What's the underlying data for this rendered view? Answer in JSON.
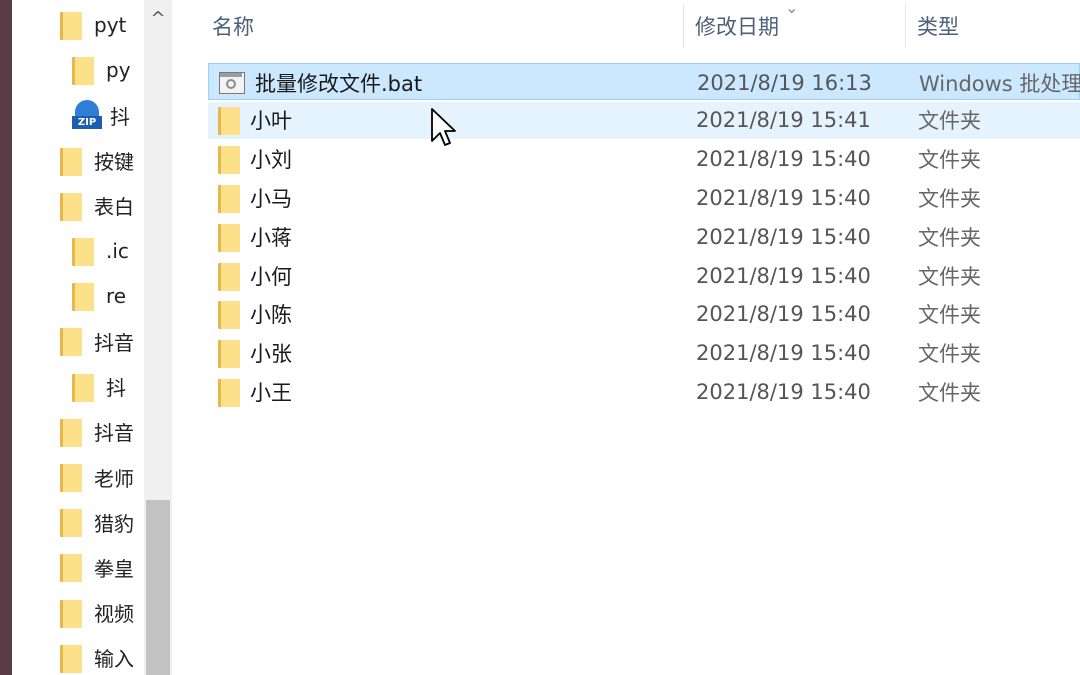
{
  "nav": {
    "items": [
      {
        "label": "pyt",
        "indent": 0,
        "icon": "folder-icon"
      },
      {
        "label": "py",
        "indent": 1,
        "icon": "folder-icon"
      },
      {
        "label": "抖",
        "indent": 1,
        "icon": "zip-icon"
      },
      {
        "label": "按键",
        "indent": 0,
        "icon": "folder-icon"
      },
      {
        "label": "表白",
        "indent": 0,
        "icon": "folder-icon"
      },
      {
        "label": ".ic",
        "indent": 1,
        "icon": "folder-icon"
      },
      {
        "label": "re",
        "indent": 1,
        "icon": "folder-icon"
      },
      {
        "label": "抖音",
        "indent": 0,
        "icon": "folder-icon"
      },
      {
        "label": "抖",
        "indent": 1,
        "icon": "folder-icon"
      },
      {
        "label": "抖音",
        "indent": 0,
        "icon": "folder-icon"
      },
      {
        "label": "老师",
        "indent": 0,
        "icon": "folder-icon"
      },
      {
        "label": "猎豹",
        "indent": 0,
        "icon": "folder-icon"
      },
      {
        "label": "拳皇",
        "indent": 0,
        "icon": "folder-icon"
      },
      {
        "label": "视频",
        "indent": 0,
        "icon": "folder-icon"
      },
      {
        "label": "输入",
        "indent": 0,
        "icon": "folder-icon"
      }
    ],
    "scroll_up_glyph": "^"
  },
  "columns": {
    "name": "名称",
    "modified": "修改日期",
    "type": "类型",
    "sort_glyph": "⌄"
  },
  "files": [
    {
      "name": "批量修改文件.bat",
      "modified": "2021/8/19 16:13",
      "type": "Windows 批处理",
      "icon": "bat-file-icon",
      "state": "selected"
    },
    {
      "name": "小叶",
      "modified": "2021/8/19 15:41",
      "type": "文件夹",
      "icon": "folder-icon",
      "state": "hover"
    },
    {
      "name": "小刘",
      "modified": "2021/8/19 15:40",
      "type": "文件夹",
      "icon": "folder-icon",
      "state": ""
    },
    {
      "name": "小马",
      "modified": "2021/8/19 15:40",
      "type": "文件夹",
      "icon": "folder-icon",
      "state": ""
    },
    {
      "name": "小蒋",
      "modified": "2021/8/19 15:40",
      "type": "文件夹",
      "icon": "folder-icon",
      "state": ""
    },
    {
      "name": "小何",
      "modified": "2021/8/19 15:40",
      "type": "文件夹",
      "icon": "folder-icon",
      "state": ""
    },
    {
      "name": "小陈",
      "modified": "2021/8/19 15:40",
      "type": "文件夹",
      "icon": "folder-icon",
      "state": ""
    },
    {
      "name": "小张",
      "modified": "2021/8/19 15:40",
      "type": "文件夹",
      "icon": "folder-icon",
      "state": ""
    },
    {
      "name": "小王",
      "modified": "2021/8/19 15:40",
      "type": "文件夹",
      "icon": "folder-icon",
      "state": ""
    }
  ],
  "colors": {
    "selected_bg": "#cce8ff",
    "selected_border": "#99d1ff",
    "hover_bg": "#e5f3ff",
    "header_text": "#4c607a",
    "folder_yellow": "#fde08a"
  }
}
